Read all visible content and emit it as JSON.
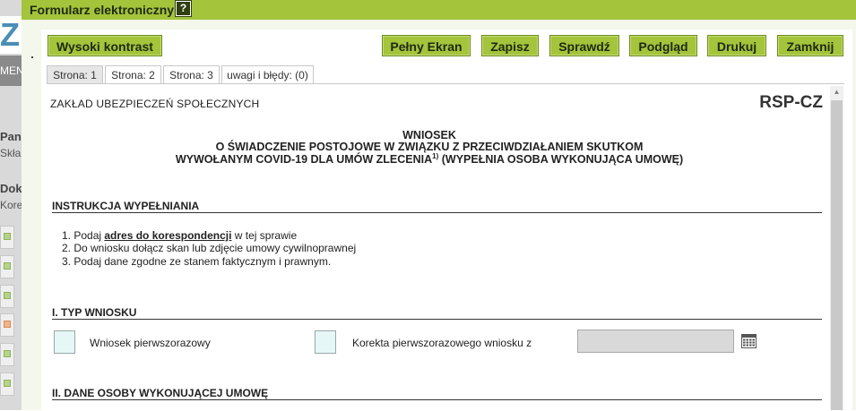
{
  "background": {
    "logo_fragment": "ZU",
    "menu_fragment": "MEN",
    "lines": [
      "Pan",
      "Skła",
      "Dok",
      "Kore"
    ]
  },
  "dialog": {
    "title": "Formularz elektroniczny",
    "help_glyph": "?",
    "accent_color": "#a3c43b"
  },
  "toolbar": {
    "high_contrast": "Wysoki kontrast",
    "fullscreen": "Pełny Ekran",
    "save": "Zapisz",
    "check": "Sprawdź",
    "preview": "Podgląd",
    "print": "Drukuj",
    "close": "Zamknij"
  },
  "tabs": [
    {
      "label": "Strona: 1"
    },
    {
      "label": "Strona: 2"
    },
    {
      "label": "Strona: 3"
    },
    {
      "label": "uwagi i błędy: (0)"
    }
  ],
  "form": {
    "institution": "ZAKŁAD UBEZPIECZEŃ SPOŁECZNYCH",
    "code": "RSP-CZ",
    "heading_line1": "WNIOSEK",
    "heading_line2": "O ŚWIADCZENIE POSTOJOWE W ZWIĄZKU Z PRZECIWDZIAŁANIEM SKUTKOM",
    "heading_line3": "WYWOŁANYM COVID-19 DLA UMÓW ZLECENIA",
    "heading_sup": "1)",
    "heading_line3_suffix": " (WYPEŁNIA OSOBA WYKONUJĄCA UMOWĘ)",
    "instructions_title": "INSTRUKCJA WYPEŁNIANIA",
    "instructions": {
      "item1_prefix": "1. Podaj ",
      "item1_bold": "adres do korespondencji",
      "item1_suffix": " w tej sprawie",
      "item2": "2. Do wniosku dołącz skan lub zdjęcie umowy cywilnoprawnej",
      "item3": "3. Podaj dane zgodne ze stanem faktycznym i prawnym."
    },
    "section1_title": "I. TYP WNIOSKU",
    "option_first": "Wniosek pierwszorazowy",
    "option_correction": "Korekta pierwszorazowego wniosku z",
    "date_value": "",
    "section2_title": "II. DANE OSOBY WYKONUJĄCEJ UMOWĘ"
  }
}
